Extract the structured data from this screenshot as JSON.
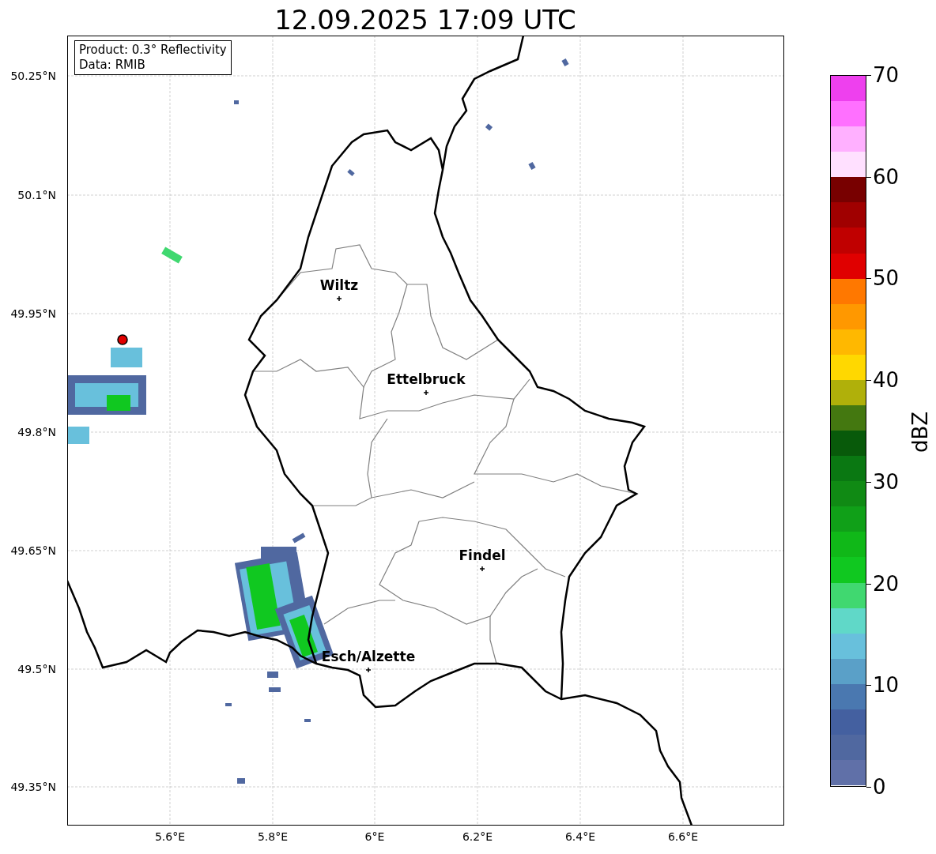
{
  "title": "12.09.2025 17:09 UTC",
  "info_box": [
    "Product: 0.3° Reflectivity",
    "Data: RMIB"
  ],
  "y_ticks": [
    "50.25°N",
    "50.1°N",
    "49.95°N",
    "49.8°N",
    "49.65°N",
    "49.5°N",
    "49.35°N"
  ],
  "x_ticks": [
    "5.6°E",
    "5.8°E",
    "6°E",
    "6.2°E",
    "6.4°E",
    "6.6°E"
  ],
  "cities": [
    {
      "name": "Wiltz"
    },
    {
      "name": "Ettelbruck"
    },
    {
      "name": "Findel"
    },
    {
      "name": "Esch/Alzette"
    }
  ],
  "colorbar": {
    "label": "dBZ",
    "ticks": [
      "70",
      "60",
      "50",
      "40",
      "30",
      "20",
      "10",
      "0"
    ],
    "bands": [
      {
        "color": "#ee40ee"
      },
      {
        "color": "#ff70ff"
      },
      {
        "color": "#ffb0ff"
      },
      {
        "color": "#ffe0ff"
      },
      {
        "color": "#780000"
      },
      {
        "color": "#a00000"
      },
      {
        "color": "#c00000"
      },
      {
        "color": "#e00000"
      },
      {
        "color": "#ff7800"
      },
      {
        "color": "#ff9800"
      },
      {
        "color": "#ffb800"
      },
      {
        "color": "#ffd800"
      },
      {
        "color": "#b0b00a"
      },
      {
        "color": "#447810"
      },
      {
        "color": "#085a0a"
      },
      {
        "color": "#0a7812"
      },
      {
        "color": "#108a14"
      },
      {
        "color": "#10a018"
      },
      {
        "color": "#10b818"
      },
      {
        "color": "#10c820"
      },
      {
        "color": "#40d870"
      },
      {
        "color": "#60d8c8"
      },
      {
        "color": "#68c0dc"
      },
      {
        "color": "#5aa0c8"
      },
      {
        "color": "#4a78b0"
      },
      {
        "color": "#4460a0"
      },
      {
        "color": "#5068a0"
      },
      {
        "color": "#6070a8"
      }
    ]
  }
}
